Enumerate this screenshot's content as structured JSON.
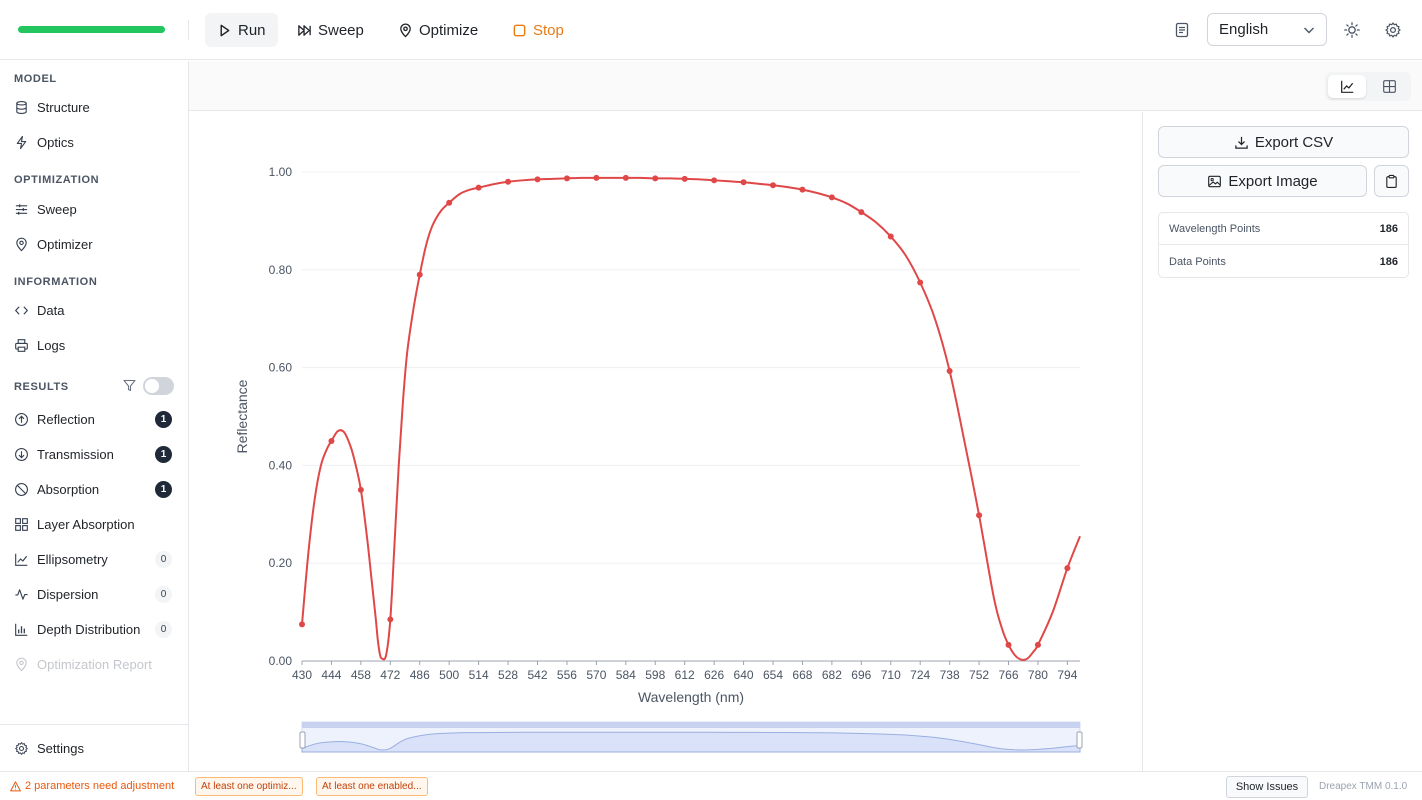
{
  "toolbar": {
    "progress": 1.0,
    "run_label": "Run",
    "sweep_label": "Sweep",
    "optimize_label": "Optimize",
    "stop_label": "Stop",
    "language": "English",
    "stop_color": "#ea7b12",
    "progress_color": "#22c55e"
  },
  "sidebar": {
    "model_label": "MODEL",
    "structure": "Structure",
    "optics": "Optics",
    "optimization_label": "OPTIMIZATION",
    "sweep": "Sweep",
    "optimizer": "Optimizer",
    "information_label": "INFORMATION",
    "data": "Data",
    "logs": "Logs",
    "results_label": "RESULTS",
    "results": [
      {
        "label": "Reflection",
        "count": "1"
      },
      {
        "label": "Transmission",
        "count": "1"
      },
      {
        "label": "Absorption",
        "count": "1"
      },
      {
        "label": "Layer Absorption",
        "count": ""
      },
      {
        "label": "Ellipsometry",
        "count": "0"
      },
      {
        "label": "Dispersion",
        "count": "0"
      },
      {
        "label": "Depth Distribution",
        "count": "0"
      },
      {
        "label": "Optimization Report",
        "count": ""
      }
    ],
    "settings": "Settings"
  },
  "panel": {
    "export_csv": "Export CSV",
    "export_image": "Export Image",
    "stats": [
      {
        "label": "Wavelength Points",
        "value": "186"
      },
      {
        "label": "Data Points",
        "value": "186"
      }
    ]
  },
  "status": {
    "warning": "2 parameters need adjustment",
    "chips": [
      "At least one optimiz...",
      "At least one enabled..."
    ],
    "show_issues": "Show Issues",
    "version": "Dreapex TMM 0.1.0"
  },
  "chart_data": {
    "type": "line",
    "title": "",
    "xlabel": "Wavelength (nm)",
    "ylabel": "Reflectance",
    "xlim": [
      430,
      800
    ],
    "ylim": [
      0,
      1
    ],
    "x_ticks": [
      430,
      444,
      458,
      472,
      486,
      500,
      514,
      528,
      542,
      556,
      570,
      584,
      598,
      612,
      626,
      640,
      654,
      668,
      682,
      696,
      710,
      724,
      738,
      752,
      766,
      780,
      794
    ],
    "y_ticks": [
      "0.00",
      "0.20",
      "0.40",
      "0.60",
      "0.80",
      "1.00"
    ],
    "line_color": "#e04848",
    "grid": true,
    "markers": {
      "x": [
        430,
        444,
        458,
        472,
        486,
        500,
        514,
        528,
        542,
        556,
        570,
        584,
        598,
        612,
        626,
        640,
        654,
        668,
        682,
        696,
        710,
        724,
        738,
        752,
        766,
        780,
        794
      ],
      "y": [
        0.075,
        0.45,
        0.35,
        0.085,
        0.79,
        0.937,
        0.968,
        0.98,
        0.985,
        0.987,
        0.988,
        0.988,
        0.987,
        0.986,
        0.983,
        0.979,
        0.973,
        0.964,
        0.948,
        0.918,
        0.868,
        0.774,
        0.593,
        0.298,
        0.033,
        0.033,
        0.19
      ]
    },
    "curve": {
      "x": [
        430,
        433,
        436,
        439,
        442,
        444,
        447,
        450,
        453,
        455,
        458,
        461,
        463,
        465,
        466,
        467,
        468,
        470,
        472,
        474,
        476,
        478,
        480,
        483,
        486,
        489,
        492,
        496,
        500,
        505,
        510,
        514,
        521,
        528,
        535,
        542,
        549,
        556,
        563,
        570,
        577,
        584,
        591,
        598,
        605,
        612,
        619,
        626,
        633,
        640,
        647,
        654,
        661,
        668,
        675,
        682,
        689,
        696,
        703,
        710,
        717,
        724,
        731,
        738,
        745,
        752,
        759,
        763,
        766,
        769,
        772,
        775,
        778,
        780,
        787,
        794,
        800
      ],
      "y": [
        0.075,
        0.22,
        0.33,
        0.4,
        0.435,
        0.45,
        0.47,
        0.468,
        0.44,
        0.41,
        0.35,
        0.25,
        0.17,
        0.09,
        0.045,
        0.015,
        0.005,
        0.012,
        0.085,
        0.24,
        0.4,
        0.53,
        0.63,
        0.72,
        0.79,
        0.85,
        0.89,
        0.92,
        0.937,
        0.955,
        0.964,
        0.968,
        0.975,
        0.98,
        0.983,
        0.985,
        0.986,
        0.987,
        0.988,
        0.988,
        0.988,
        0.988,
        0.988,
        0.987,
        0.987,
        0.986,
        0.985,
        0.983,
        0.981,
        0.979,
        0.976,
        0.973,
        0.969,
        0.964,
        0.957,
        0.948,
        0.936,
        0.918,
        0.897,
        0.868,
        0.83,
        0.774,
        0.7,
        0.593,
        0.45,
        0.298,
        0.13,
        0.065,
        0.033,
        0.012,
        0.003,
        0.005,
        0.02,
        0.033,
        0.1,
        0.19,
        0.255
      ]
    }
  }
}
